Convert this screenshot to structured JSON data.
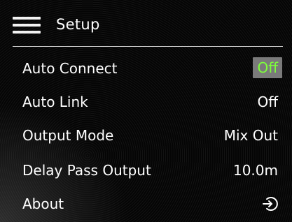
{
  "header": {
    "title": "Setup",
    "menu_icon": "hamburger-menu-icon"
  },
  "settings": [
    {
      "label": "Auto Connect",
      "value": "Off",
      "highlighted": true
    },
    {
      "label": "Auto Link",
      "value": "Off"
    },
    {
      "label": "Output Mode",
      "value": "Mix Out"
    },
    {
      "label": "Delay Pass Output",
      "value": "10.0m"
    },
    {
      "label": "About",
      "icon": "enter-arrow-icon"
    }
  ],
  "colors": {
    "background": "#050505",
    "text": "#ffffff",
    "highlight_bg": "#7a7a7a",
    "highlight_text": "#7dff3a",
    "divider": "#d8d8d8"
  }
}
